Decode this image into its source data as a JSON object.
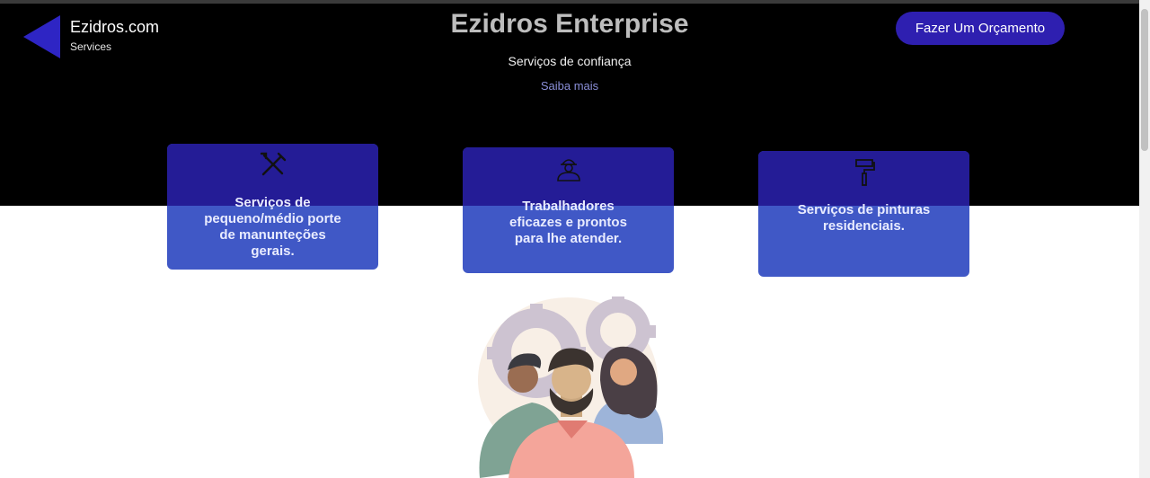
{
  "logo": {
    "name": "Ezidros.com",
    "subtitle": "Services",
    "icon": "triangle-left-icon"
  },
  "hero": {
    "title": "Ezidros Enterprise",
    "subtitle": "Serviços de confiança",
    "link": "Saiba mais"
  },
  "cta": {
    "label": "Fazer Um Orçamento"
  },
  "cards": [
    {
      "icon": "tools-icon",
      "text": "Serviços de pequeno/médio porte de manunteções gerais."
    },
    {
      "icon": "worker-icon",
      "text": "Trabalhadores eficazes e prontos para lhe atender."
    },
    {
      "icon": "paint-roller-icon",
      "text": "Serviços de pinturas residenciais."
    }
  ],
  "colors": {
    "hero_bg": "#000000",
    "accent": "#2e1fb0",
    "card_top": "#241c96",
    "card_bottom": "#4058c6"
  }
}
